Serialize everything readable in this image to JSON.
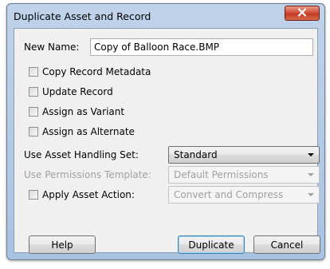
{
  "window": {
    "title": "Duplicate Asset and Record",
    "close_icon": "close-icon"
  },
  "form": {
    "new_name_label": "New Name:",
    "new_name_value": "Copy of Balloon Race.BMP",
    "copy_metadata_label": "Copy Record Metadata",
    "update_record_label": "Update Record",
    "assign_variant_label": "Assign as Variant",
    "assign_alternate_label": "Assign as Alternate",
    "handling_set_label": "Use Asset Handling Set:",
    "handling_set_value": "Standard",
    "permissions_label": "Use Permissions Template:",
    "permissions_value": "Default Permissions",
    "asset_action_label": "Apply Asset Action:",
    "asset_action_value": "Convert and Compress"
  },
  "buttons": {
    "help": "Help",
    "duplicate": "Duplicate",
    "cancel": "Cancel"
  }
}
